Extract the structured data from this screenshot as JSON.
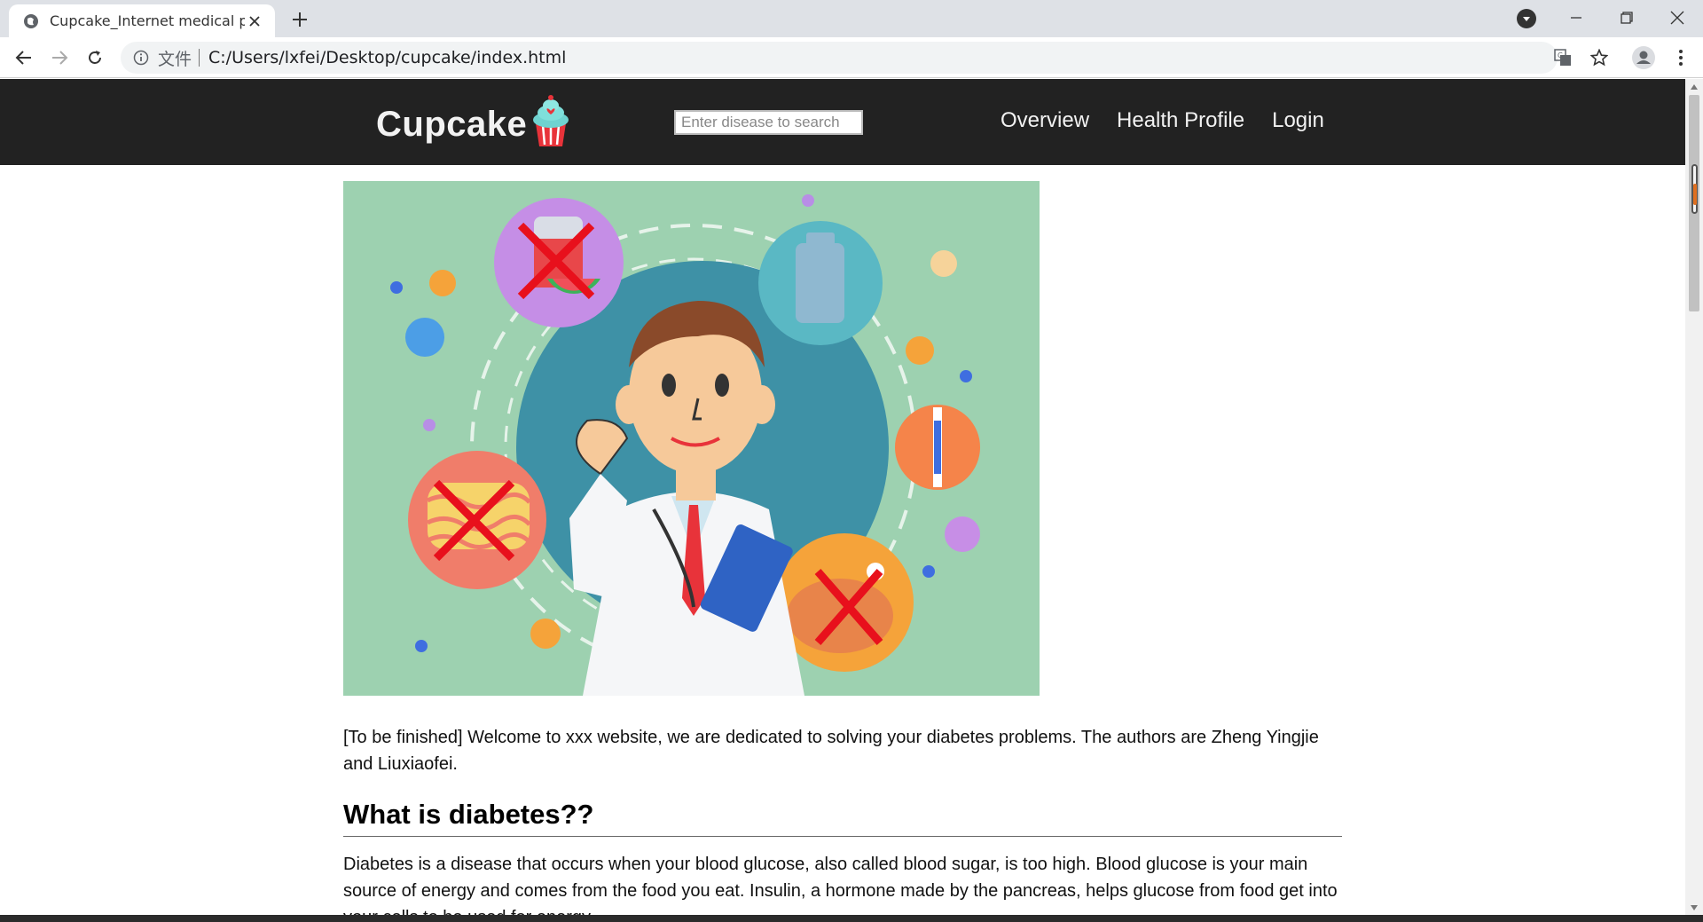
{
  "browser": {
    "tab_title": "Cupcake_Internet medical plat",
    "url_scheme_label": "文件",
    "url": "C:/Users/lxfei/Desktop/cupcake/index.html"
  },
  "site": {
    "brand": "Cupcake",
    "search_placeholder": "Enter disease to search",
    "nav": [
      "Overview",
      "Health Profile",
      "Login"
    ]
  },
  "content": {
    "intro": "[To be finished] Welcome to xxx website, we are dedicated to solving your diabetes problems. The authors are Zheng Yingjie and Liuxiaofei.",
    "section_title": "What is diabetes??",
    "section_text": "Diabetes is a disease that occurs when your blood glucose, also called blood sugar, is too high. Blood glucose is your main source of energy and comes from the food you eat. Insulin, a hormone made by the pancreas, helps glucose from food get into your cells to be used for energy."
  },
  "icons": {
    "favicon": "globe-icon",
    "tab_close": "close-icon",
    "new_tab": "plus-icon",
    "back": "arrow-left-icon",
    "forward": "arrow-right-icon",
    "reload": "reload-icon",
    "info": "info-icon",
    "translate": "translate-icon",
    "bookmark": "star-icon",
    "profile": "account-icon",
    "menu": "kebab-menu-icon"
  },
  "colors": {
    "nav_bg": "#222222",
    "hero_bg": "#9dd1b0",
    "tabstrip_bg": "#dee1e6"
  }
}
